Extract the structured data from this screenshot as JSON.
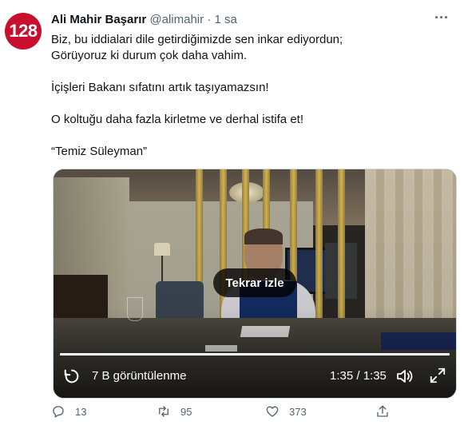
{
  "tweet": {
    "avatar_text": "128",
    "author_name": "Ali Mahir Başarır",
    "handle": "@alimahir",
    "dot": "·",
    "time": "1 sa",
    "more_label": "···",
    "lines": [
      "Biz, bu iddialari dile getirdiğimizde sen inkar ediyordun;",
      "Görüyoruz ki durum çok daha vahim.",
      "İçişleri Bakanı sıfatını artık taşıyamazsın!",
      "O koltuğu daha fazla kirletme ve derhal istifa et!",
      "“Temiz Süleyman”"
    ]
  },
  "video": {
    "replay_label": "Tekrar izle",
    "views": "7 B görüntülenme",
    "time_readout": "1:35 / 1:35",
    "progress": 1.0,
    "icons": {
      "replay": "replay-icon",
      "volume": "volume-icon",
      "fullscreen": "fullscreen-icon"
    }
  },
  "actions": {
    "reply_count": "13",
    "retweet_count": "95",
    "like_count": "373",
    "icons": [
      "reply-icon",
      "retweet-icon",
      "like-icon",
      "share-icon"
    ]
  },
  "colors": {
    "avatar_bg": "#c8102e",
    "text": "#0f1419",
    "muted": "#536471"
  }
}
